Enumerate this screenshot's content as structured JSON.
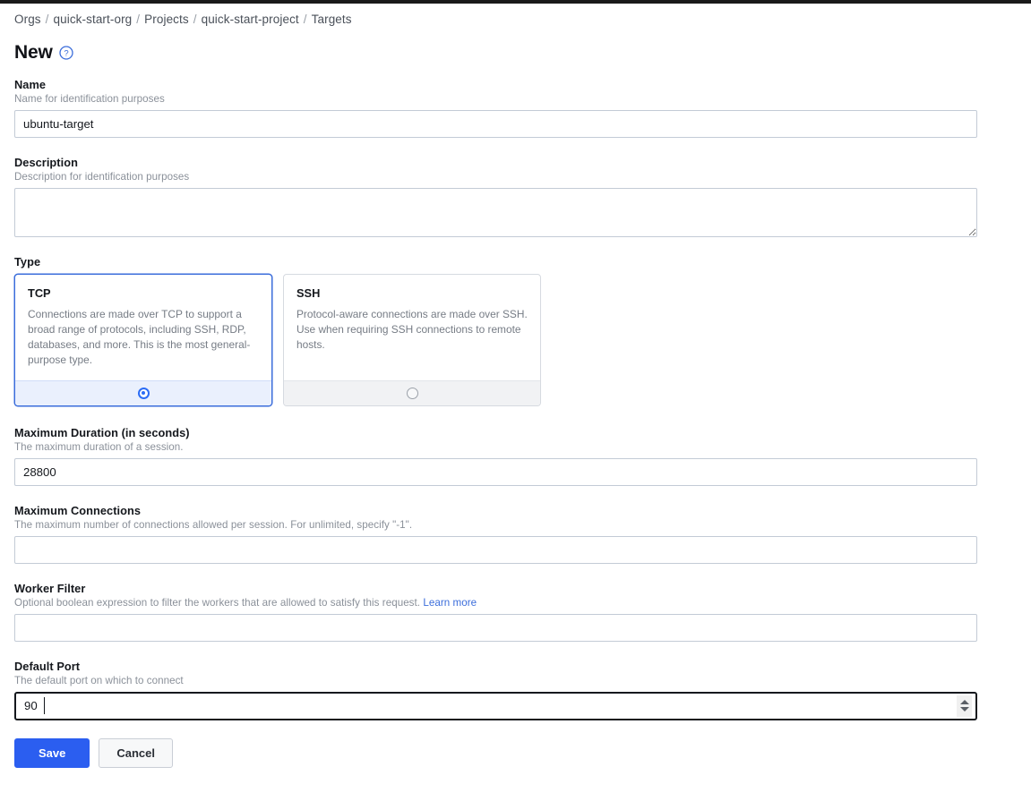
{
  "breadcrumb": {
    "items": [
      {
        "label": "Orgs"
      },
      {
        "label": "quick-start-org"
      },
      {
        "label": "Projects"
      },
      {
        "label": "quick-start-project"
      },
      {
        "label": "Targets"
      }
    ],
    "separator": "/"
  },
  "header": {
    "title": "New",
    "help_icon": "question-circle-icon"
  },
  "form": {
    "name": {
      "label": "Name",
      "help": "Name for identification purposes",
      "value": "ubuntu-target",
      "placeholder": ""
    },
    "description": {
      "label": "Description",
      "help": "Description for identification purposes",
      "value": "",
      "placeholder": ""
    },
    "type": {
      "label": "Type",
      "options": [
        {
          "title": "TCP",
          "description": "Connections are made over TCP to support a broad range of protocols, including SSH, RDP, databases, and more. This is the most general-purpose type.",
          "selected": true
        },
        {
          "title": "SSH",
          "description": "Protocol-aware connections are made over SSH. Use when requiring SSH connections to remote hosts.",
          "selected": false
        }
      ]
    },
    "maximum_duration": {
      "label": "Maximum Duration (in seconds)",
      "help": "The maximum duration of a session.",
      "value": "28800",
      "placeholder": ""
    },
    "maximum_connections": {
      "label": "Maximum Connections",
      "help": "The maximum number of connections allowed per session. For unlimited, specify \"-1\".",
      "value": "",
      "placeholder": ""
    },
    "worker_filter": {
      "label": "Worker Filter",
      "help": "Optional boolean expression to filter the workers that are allowed to satisfy this request.",
      "link_label": "Learn more",
      "value": "",
      "placeholder": ""
    },
    "default_port": {
      "label": "Default Port",
      "help": "The default port on which to connect",
      "value": "90",
      "placeholder": "",
      "focused": true
    }
  },
  "actions": {
    "save_label": "Save",
    "cancel_label": "Cancel"
  },
  "colors": {
    "accent": "#2b5ef0",
    "link": "#3b6ddb",
    "selected_card_border": "#3b6ddb",
    "selected_card_footer": "#eaf0fd",
    "text": "#15181d",
    "muted_text": "#8a9099"
  }
}
